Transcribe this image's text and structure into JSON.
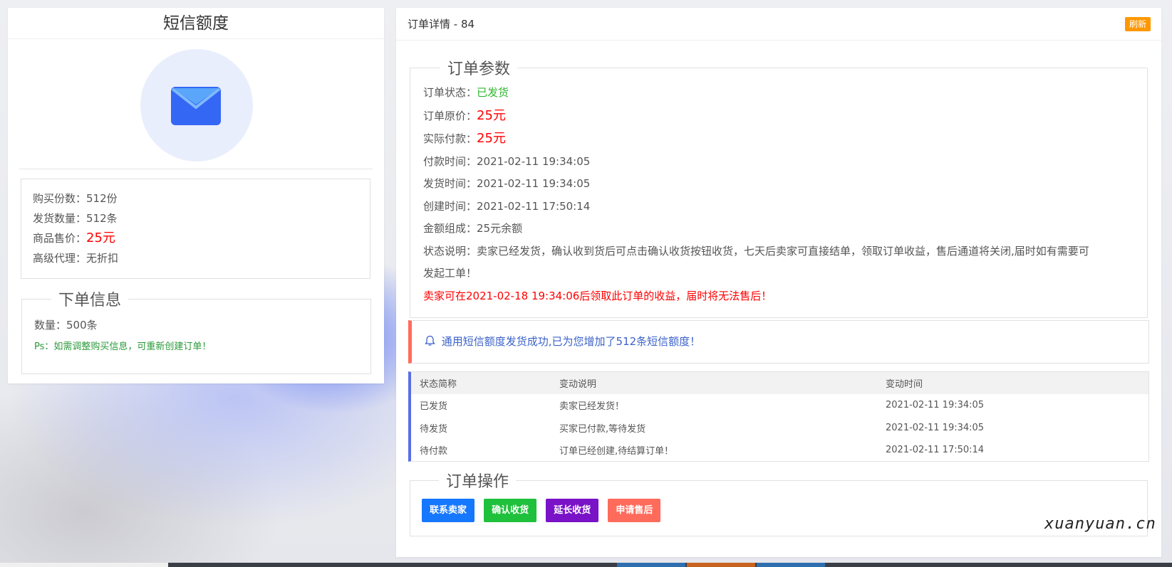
{
  "left": {
    "title": "短信额度",
    "icon": "envelope-icon",
    "info": [
      {
        "label": "购买份数：",
        "value": "512份"
      },
      {
        "label": "发货数量：",
        "value": "512条"
      },
      {
        "label": "商品售价：",
        "value": "25元"
      },
      {
        "label": "高级代理：",
        "value": "无折扣"
      }
    ],
    "order_info": {
      "legend": "下单信息",
      "qty_label": "数量：",
      "qty_value": "500条",
      "ps": "Ps：如需调整购买信息，可重新创建订单！"
    }
  },
  "right": {
    "header": "订单详情 - 84",
    "refresh_label": "刷新",
    "params": {
      "legend": "订单参数",
      "status_label": "订单状态：",
      "status_value": "已发货",
      "orig_price_label": "订单原价：",
      "orig_price_value": "25元",
      "paid_label": "实际付款：",
      "paid_value": "25元",
      "pay_time_label": "付款时间：",
      "pay_time_value": "2021-02-11 19:34:05",
      "ship_time_label": "发货时间：",
      "ship_time_value": "2021-02-11 19:34:05",
      "create_time_label": "创建时间：",
      "create_time_value": "2021-02-11 17:50:14",
      "amount_label": "金额组成：",
      "amount_value": "25元余额",
      "desc_label": "状态说明：",
      "desc_line1": "卖家已经发货，确认收到货后可点击确认收货按钮收货，七天后卖家可直接结单，领取订单收益，售后通道将关闭,届时如有需要可",
      "desc_line2": "发起工单！",
      "warning": "卖家可在2021-02-18 19:34:06后领取此订单的收益，届时将无法售后！"
    },
    "alert": "通用短信额度发货成功,已为您增加了512条短信额度！",
    "log": {
      "headers": [
        "状态简称",
        "变动说明",
        "变动时间"
      ],
      "rows": [
        [
          "已发货",
          "卖家已经发货！",
          "2021-02-11 19:34:05"
        ],
        [
          "待发货",
          "买家已付款,等待发货",
          "2021-02-11 19:34:05"
        ],
        [
          "待付款",
          "订单已经创建,待结算订单！",
          "2021-02-11 17:50:14"
        ]
      ]
    },
    "ops": {
      "legend": "订单操作",
      "contact": "联系卖家",
      "confirm": "确认收货",
      "extend": "延长收货",
      "aftersale": "申请售后"
    }
  },
  "watermark": "xuanyuan.cn",
  "colors": {
    "accent_blue": "#1677ff",
    "green": "#1fc03b",
    "purple": "#7a12c8",
    "salmon": "#ff6b5b",
    "orange": "#ff9800",
    "price_red": "#ff0000"
  }
}
